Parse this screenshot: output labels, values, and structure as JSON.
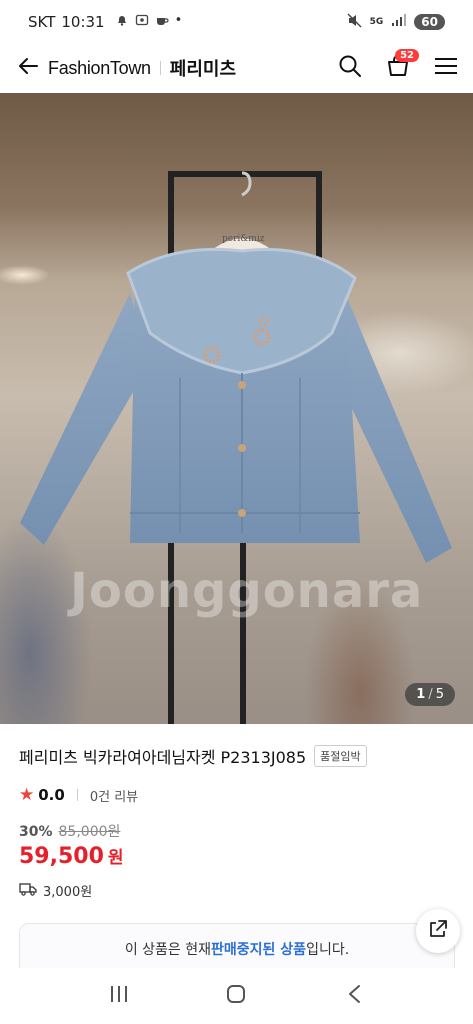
{
  "status_bar": {
    "carrier": "SKT",
    "time": "10:31",
    "network": "5G",
    "battery": "60"
  },
  "header": {
    "brand": "FashionTown",
    "store": "페리미츠",
    "cart_count": "52",
    "icons": [
      "back-arrow-icon",
      "search-icon",
      "cart-icon",
      "menu-icon"
    ]
  },
  "hero": {
    "current": "1",
    "total": "5",
    "watermark": "Joonggonara"
  },
  "product": {
    "title": "페리미츠 빅카라여아데님자켓 P2313J085",
    "tag": "품절임박",
    "rating": "0.0",
    "reviews": "0건 리뷰",
    "discount": "30%",
    "original_price": "85,000원",
    "price": "59,500",
    "price_unit": "원",
    "shipping": "3,000원"
  },
  "notice": {
    "prefix": "이 상품은 현재 ",
    "highlight": "판매중지된 상품",
    "suffix": "입니다."
  },
  "colors": {
    "price_red": "#e5202b",
    "badge_red": "#ff3b3b",
    "notice_blue": "#2b6fd6"
  }
}
